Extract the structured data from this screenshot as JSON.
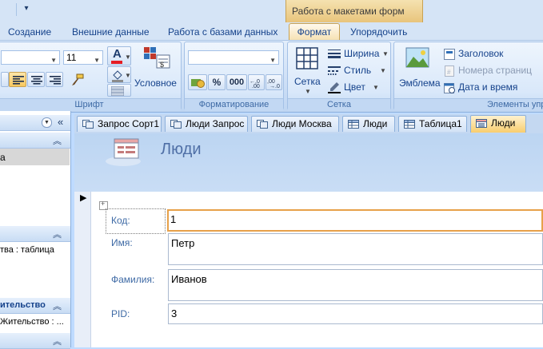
{
  "ribbon": {
    "context_title": "Работа с макетами форм",
    "tabs": [
      "Создание",
      "Внешние данные",
      "Работа с базами данных",
      "Формат",
      "Упорядочить"
    ],
    "font_size": "11",
    "groups": {
      "font": "Шрифт",
      "formatting": "Форматирование",
      "gridlines": "Сетка",
      "controls": "Элементы упр"
    },
    "conditional_label": "Условное",
    "percent": "%",
    "thousands": "000",
    "gridlines_label": "Сетка",
    "width_label": "Ширина",
    "style_label": "Стиль",
    "color_label": "Цвет",
    "logo_label": "Эмблема",
    "title_label": "Заголовок",
    "page_numbers_label": "Номера страниц",
    "date_time_label": "Дата и время"
  },
  "nav_pane": {
    "selected_item": "а",
    "items": [
      "тва : таблица",
      "ительство",
      "Жительство : ..."
    ]
  },
  "doc_tabs": [
    {
      "label": "Запрос Сорт1",
      "icon": "query-icon"
    },
    {
      "label": "Люди Запрос",
      "icon": "query-icon"
    },
    {
      "label": "Люди Москва",
      "icon": "query-icon"
    },
    {
      "label": "Люди",
      "icon": "table-icon"
    },
    {
      "label": "Таблица1",
      "icon": "table-icon"
    },
    {
      "label": "Люди",
      "icon": "form-icon"
    }
  ],
  "form": {
    "title": "Люди",
    "fields": [
      {
        "label": "Код:",
        "value": "1"
      },
      {
        "label": "Имя:",
        "value": "Петр"
      },
      {
        "label": "Фамилия:",
        "value": "Иванов"
      },
      {
        "label": "PID:",
        "value": "3"
      }
    ]
  }
}
